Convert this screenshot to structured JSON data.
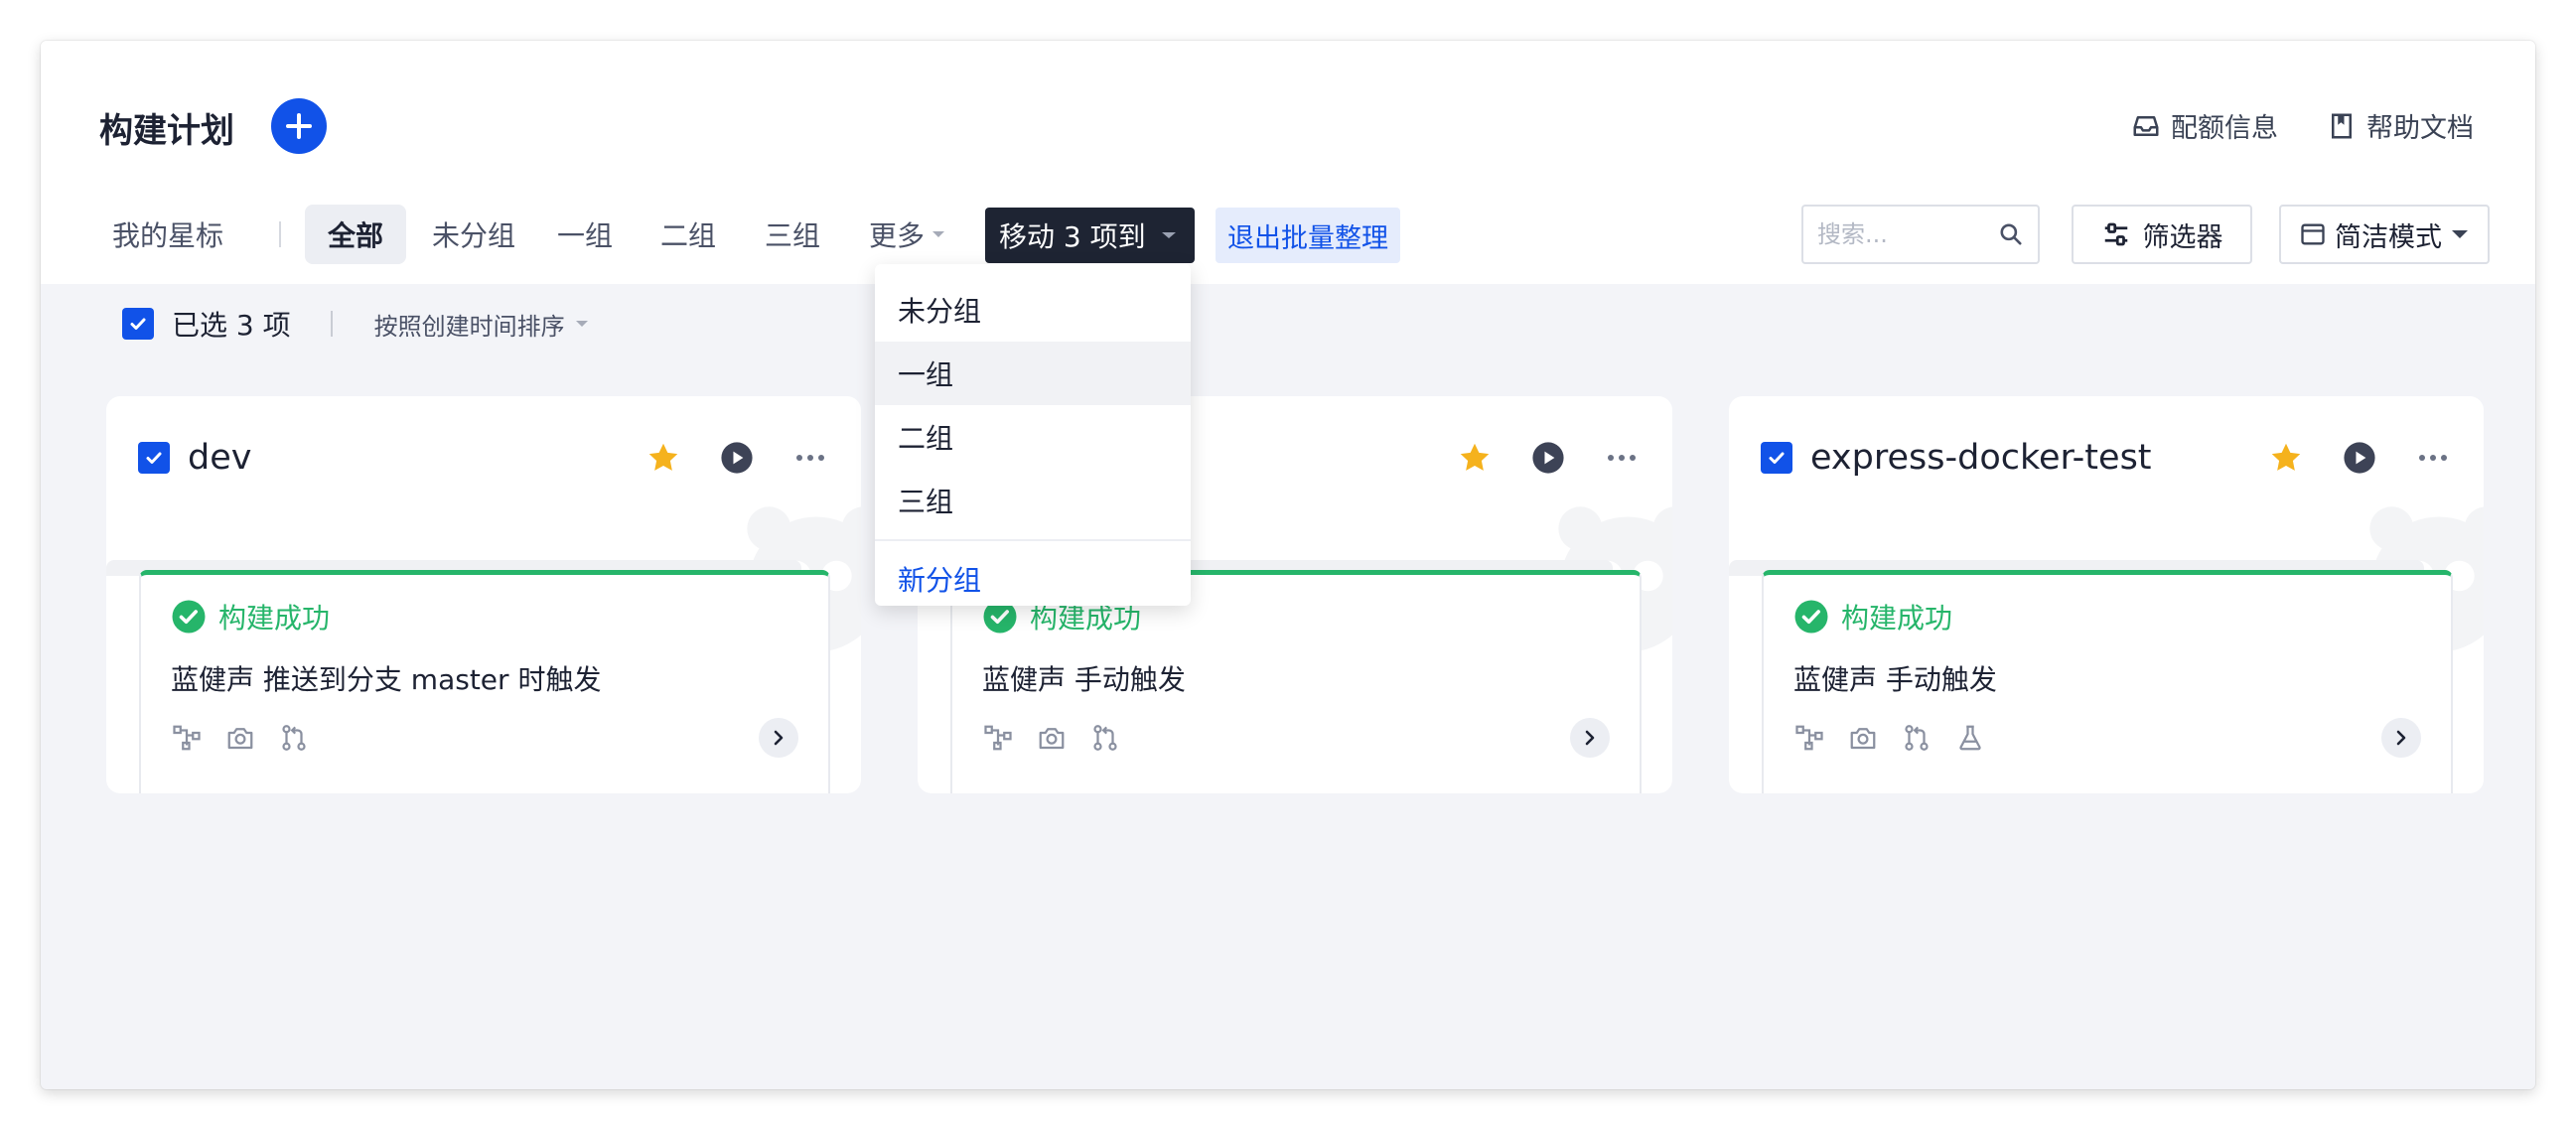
{
  "header": {
    "title": "构建计划",
    "quota_label": "配额信息",
    "help_label": "帮助文档"
  },
  "tabs": [
    {
      "label": "我的星标"
    },
    {
      "label": "全部"
    },
    {
      "label": "未分组"
    },
    {
      "label": "一组"
    },
    {
      "label": "二组"
    },
    {
      "label": "三组"
    },
    {
      "label": "更多"
    }
  ],
  "batch": {
    "move_label": "移动 3 项到",
    "exit_label": "退出批量整理"
  },
  "toolbar": {
    "search_placeholder": "搜索...",
    "filter_label": "筛选器",
    "mode_label": "简洁模式"
  },
  "selection": {
    "selected_text": "已选 3 项",
    "sort_label": "按照创建时间排序"
  },
  "dropdown": {
    "items": [
      {
        "label": "未分组"
      },
      {
        "label": "一组"
      },
      {
        "label": "二组"
      },
      {
        "label": "三组"
      }
    ],
    "new_group": "新分组"
  },
  "cards": [
    {
      "name": "dev",
      "status": "构建成功",
      "trigger": "蓝健声 推送到分支 master 时触发"
    },
    {
      "name": "",
      "status": "构建成功",
      "trigger": "蓝健声 手动触发"
    },
    {
      "name": "express-docker-test",
      "status": "构建成功",
      "trigger": "蓝健声 手动触发"
    }
  ],
  "colors": {
    "primary": "#1152e8",
    "success": "#26b56a",
    "star": "#f5b21d",
    "dark_button": "#1e2433"
  }
}
